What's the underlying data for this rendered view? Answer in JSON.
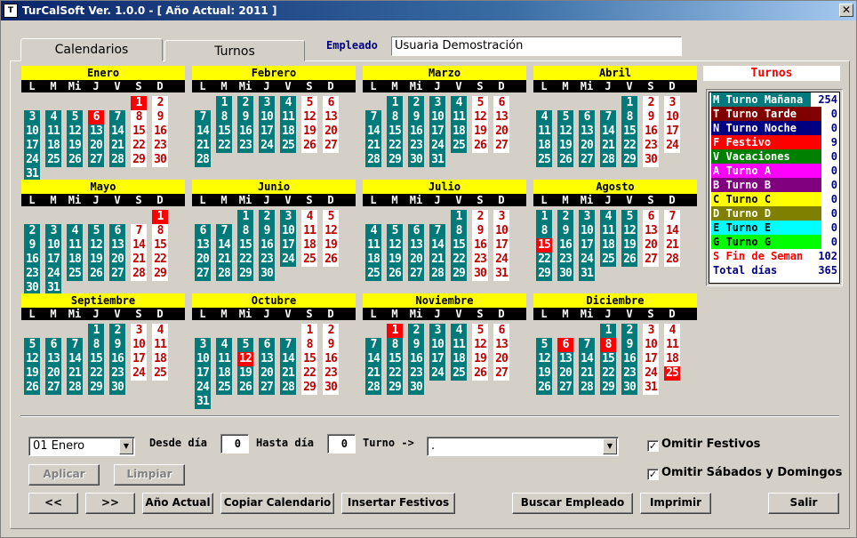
{
  "window": {
    "title": "TurCalSoft Ver. 1.0.0 - [ Año Actual: 2011 ]",
    "app_icon": "T",
    "close": "✕"
  },
  "tabs": {
    "calendarios": "Calendarios",
    "turnos": "Turnos"
  },
  "empleado": {
    "label": "Empleado",
    "value": "Usuaria Demostración"
  },
  "weekday_headers": [
    "L",
    "M",
    "Mi",
    "J",
    "V",
    "S",
    "D"
  ],
  "months": [
    {
      "name": "Enero",
      "start": 5,
      "days": 31,
      "holidays": [
        1,
        6
      ]
    },
    {
      "name": "Febrero",
      "start": 1,
      "days": 28,
      "holidays": []
    },
    {
      "name": "Marzo",
      "start": 1,
      "days": 31,
      "holidays": []
    },
    {
      "name": "Abril",
      "start": 4,
      "days": 30,
      "holidays": []
    },
    {
      "name": "Mayo",
      "start": 6,
      "days": 31,
      "holidays": [
        1
      ]
    },
    {
      "name": "Junio",
      "start": 2,
      "days": 30,
      "holidays": []
    },
    {
      "name": "Julio",
      "start": 4,
      "days": 31,
      "holidays": []
    },
    {
      "name": "Agosto",
      "start": 0,
      "days": 31,
      "holidays": [
        15
      ]
    },
    {
      "name": "Septiembre",
      "start": 3,
      "days": 30,
      "holidays": []
    },
    {
      "name": "Octubre",
      "start": 5,
      "days": 31,
      "holidays": [
        12
      ]
    },
    {
      "name": "Noviembre",
      "start": 1,
      "days": 30,
      "holidays": [
        1
      ]
    },
    {
      "name": "Diciembre",
      "start": 3,
      "days": 31,
      "holidays": [
        6,
        8,
        25
      ]
    }
  ],
  "turnos": {
    "title": "Turnos",
    "items": [
      {
        "code": "M",
        "name": "Turno Mañana",
        "count": "254",
        "bg": "#007a7a",
        "fg": "#ffffff"
      },
      {
        "code": "T",
        "name": "Turno Tarde",
        "count": "0",
        "bg": "#800000",
        "fg": "#ffffff"
      },
      {
        "code": "N",
        "name": "Turno Noche",
        "count": "0",
        "bg": "#000080",
        "fg": "#ffffff"
      },
      {
        "code": "F",
        "name": "Festivo",
        "count": "9",
        "bg": "#ff0000",
        "fg": "#ffffff"
      },
      {
        "code": "V",
        "name": "Vacaciones",
        "count": "0",
        "bg": "#008000",
        "fg": "#ffffff"
      },
      {
        "code": "A",
        "name": "Turno A",
        "count": "0",
        "bg": "#ff00ff",
        "fg": "#ffffff"
      },
      {
        "code": "B",
        "name": "Turno B",
        "count": "0",
        "bg": "#800080",
        "fg": "#ffffff"
      },
      {
        "code": "C",
        "name": "Turno C",
        "count": "0",
        "bg": "#ffff00",
        "fg": "#000000"
      },
      {
        "code": "D",
        "name": "Turno D",
        "count": "0",
        "bg": "#808000",
        "fg": "#ffffff"
      },
      {
        "code": "E",
        "name": "Turno E",
        "count": "0",
        "bg": "#00ffff",
        "fg": "#000000"
      },
      {
        "code": "G",
        "name": "Turno G",
        "count": "0",
        "bg": "#00ff00",
        "fg": "#000000"
      },
      {
        "code": "S",
        "name": "Fin de Seman",
        "count": "102",
        "bg": "#ffffff",
        "fg": "#ff0000"
      },
      {
        "code": "",
        "name": "Total días",
        "count": "365",
        "bg": "#ffffff",
        "fg": "#000080"
      }
    ]
  },
  "controls": {
    "month_select": "01 Enero",
    "desde_label": "Desde día",
    "desde_value": "0",
    "hasta_label": "Hasta día",
    "hasta_value": "0",
    "turno_label": "Turno ->",
    "turno_select": ".",
    "omitir_festivos": "Omitir Festivos",
    "omitir_sabados": "Omitir Sábados y Domingos",
    "check_mark": "✓"
  },
  "buttons": {
    "aplicar": "Aplicar",
    "limpiar": "Limpiar",
    "prev": "<<",
    "next": ">>",
    "anio_actual": "Año Actual",
    "copiar": "Copiar Calendario",
    "insertar": "Insertar Festivos",
    "buscar": "Buscar Empleado",
    "imprimir": "Imprimir",
    "salir": "Salir",
    "dropdown": "▼"
  }
}
